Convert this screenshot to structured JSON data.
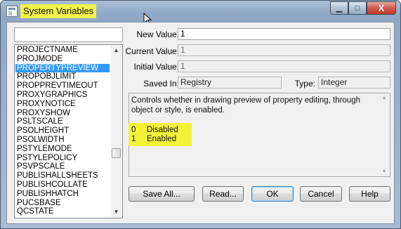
{
  "window": {
    "title": "System Variables",
    "controls": {
      "minimize": "▁",
      "maximize": "□",
      "close": "X"
    }
  },
  "search": {
    "value": ""
  },
  "variables": [
    "PROJECTNAME",
    "PROJMODE",
    "PROPERTYPREVIEW",
    "PROPOBJLIMIT",
    "PROPPREVTIMEOUT",
    "PROXYGRAPHICS",
    "PROXYNOTICE",
    "PROXYSHOW",
    "PSLTSCALE",
    "PSOLHEIGHT",
    "PSOLWIDTH",
    "PSTYLEMODE",
    "PSTYLEPOLICY",
    "PSVPSCALE",
    "PUBLISHALLSHEETS",
    "PUBLISHCOLLATE",
    "PUBLISHHATCH",
    "PUCSBASE",
    "QCSTATE"
  ],
  "selected_variable": "PROPERTYPREVIEW",
  "fields": {
    "new_value_label": "New Value:",
    "new_value": "1",
    "current_value_label": "Current Value:",
    "current_value": "1",
    "initial_value_label": "Initial Value:",
    "initial_value": "1",
    "saved_in_label": "Saved In:",
    "saved_in": "Registry",
    "type_label": "Type:",
    "type": "Integer"
  },
  "description": {
    "text": "Controls whether in drawing preview of property editing, through object or style, is enabled.",
    "options": [
      {
        "value": "0",
        "label": "Disabled"
      },
      {
        "value": "1",
        "label": "Enabled"
      }
    ]
  },
  "buttons": {
    "save_all": "Save All...",
    "read": "Read...",
    "ok": "OK",
    "cancel": "Cancel",
    "help": "Help"
  },
  "colors": {
    "highlight": "#f4f23a",
    "selection": "#3399ff"
  }
}
